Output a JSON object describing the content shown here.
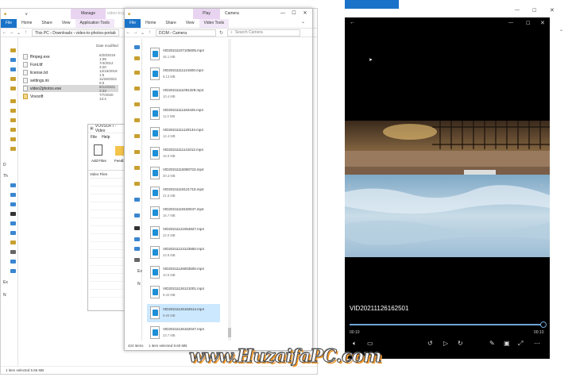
{
  "explorer1": {
    "title": "v",
    "ribbon_context": "Manage",
    "ribbon_context2": "video-to-p",
    "tabs": [
      "File",
      "Home",
      "Share",
      "View",
      "Application Tools"
    ],
    "breadcrumb": "This PC › Downloads › video-to-photos-portab",
    "column_date": "Date modified",
    "files": [
      {
        "name": "ffmpeg.exe",
        "date": "6/20/2019 1:09"
      },
      {
        "name": "Font.ttf",
        "date": "7/4/2012 3:20"
      },
      {
        "name": "license.txt",
        "date": "12/16/2019 1:5"
      },
      {
        "name": "settings.ini",
        "date": "11/26/2021 5:5"
      },
      {
        "name": "video2photos.exe",
        "date": "8/12/2021 2:23"
      },
      {
        "name": "Vovsoft",
        "date": "7/7/2020 13:4"
      }
    ],
    "nav_letters": [
      "D",
      "Th",
      "Ex",
      "N"
    ],
    "status": "1 item selected  5.56 MB"
  },
  "vidsoft": {
    "title": "VOVSOFT - Video",
    "menu": [
      "File",
      "Help"
    ],
    "add_files": "Add Files",
    "feedback": "Feedb",
    "list_header": "Video Files"
  },
  "explorer2": {
    "title": "Camera",
    "ribbon_context": "Play",
    "tabs": [
      "File",
      "Home",
      "Share",
      "View",
      "Video Tools"
    ],
    "breadcrumb": "DCIM › Camera",
    "search_placeholder": "Search Camera",
    "status_items": "424 items",
    "status_selected": "1 item selected  9.60 MB",
    "videos": [
      {
        "name": "VID20211107105605.mp4",
        "size": "45.1 MB"
      },
      {
        "name": "VID20211111121600.mp4",
        "size": "9.13 MB"
      },
      {
        "name": "VID20211111091329.mp4",
        "size": "10.4 MB"
      },
      {
        "name": "VID20211111163426.mp4",
        "size": "11.0 MB"
      },
      {
        "name": "VID20211111120134.mp4",
        "size": "12.4 MB"
      },
      {
        "name": "VID20211111141012.mp4",
        "size": "16.0 MB"
      },
      {
        "name": "VID20211115080723.mp4",
        "size": "20.3 MB"
      },
      {
        "name": "VID20211118121715.mp4",
        "size": "21.6 MB"
      },
      {
        "name": "VID20211118150047.mp4",
        "size": "16.7 MB"
      },
      {
        "name": "VID20211121064827.mp4",
        "size": "22.0 MB"
      },
      {
        "name": "VID20211123123550.mp4",
        "size": "24.9 MB"
      },
      {
        "name": "VID20211126003500.mp4",
        "size": "10.5 MB"
      },
      {
        "name": "VID20211126121001.mp4",
        "size": "9.42 MB"
      },
      {
        "name": "VID20211126162514.mp4",
        "size": "9.60 MB"
      },
      {
        "name": "VID20211126162047.mp4",
        "size": "23.7 MB"
      }
    ],
    "selected_index": 13
  },
  "player": {
    "video_title": "VID20211126162501",
    "time_current": "00:10",
    "time_total": "00:10",
    "progress": 1.0
  },
  "watermark": "www.HuzaifaPC.com",
  "colors": {
    "accent": "#1a73c8",
    "selected": "#cce8ff",
    "player_bg": "#000000"
  }
}
